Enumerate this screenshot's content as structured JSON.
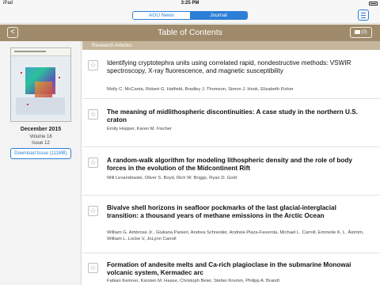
{
  "status_bar": {
    "device": "iPad",
    "time": "3:25 PM",
    "battery_percent": ""
  },
  "top_bar": {
    "segments": [
      {
        "label": "AGU News",
        "active": false
      },
      {
        "label": "Journal",
        "active": true
      }
    ],
    "menu_icon": "hamburger-icon"
  },
  "title_bar": {
    "back_label": "<",
    "title": "Table of Contents",
    "download_count": "(0)"
  },
  "issue": {
    "date": "December 2015",
    "volume": "Volume 16",
    "issue": "Issue 12",
    "download_label": "Download Issue (111MB)"
  },
  "section": {
    "label": "Research Articles"
  },
  "articles": [
    {
      "title": "Identifying cryptotephra units using correlated rapid, nondestructive methods: VSWIR spectroscopy, X-ray fluorescence, and magnetic susceptibility",
      "authors": "Molly C. McCanta, Robert G. Hatfield, Bradley J. Thomson, Simon J. Hook, Elizabeth Fisher",
      "bold": false
    },
    {
      "title": "The meaning of midlithospheric discontinuities: A case study in the northern U.S. craton",
      "authors": "Emily Hopper, Karen M. Fischer",
      "bold": true
    },
    {
      "title": "A random-walk algorithm for modeling lithospheric density and the role of body forces in the evolution of the Midcontinent Rift",
      "authors": "Will Levandowski, Oliver S. Boyd, Rich W. Briggs, Ryan D. Gold",
      "bold": true
    },
    {
      "title": "Bivalve shell horizons in seafloor pockmarks of the last glacial-interglacial transition: a thousand years of methane emissions in the Arctic Ocean",
      "authors": "William G. Ambrose Jr., Giuliana Panieri, Andrea Schneider, Andreia Plaza-Faverola, Michael L. Carroll, Emmelie K. L. Åström, William L. Locke V, JoLynn Carroll",
      "bold": true
    },
    {
      "title": "Formation of andesite melts and Ca-rich plagioclase in the submarine Monowai volcanic system, Kermadec arc",
      "authors": "Fabian Kemner, Karsten M. Haase, Christoph Beier, Stefan Krumm, Philipp A. Brandl",
      "bold": true
    }
  ],
  "colors": {
    "accent": "#2c7fd6",
    "title_bar": "#9f8b6c",
    "section_header": "#c5b69b"
  }
}
